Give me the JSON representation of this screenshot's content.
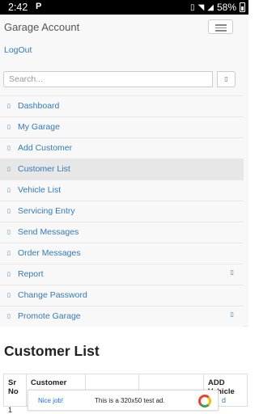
{
  "status_bar": {
    "time": "2:42",
    "battery": "58%",
    "notification_icon": "P"
  },
  "header": {
    "brand": "Garage Account",
    "logout": "LogOut"
  },
  "search": {
    "placeholder": "Search..."
  },
  "menu": {
    "items": [
      {
        "label": "Dashboard"
      },
      {
        "label": "My Garage"
      },
      {
        "label": "Add Customer"
      },
      {
        "label": "Customer List"
      },
      {
        "label": "Vehicle List"
      },
      {
        "label": "Servicing Entry"
      },
      {
        "label": "Send Messages"
      },
      {
        "label": "Order Messages"
      },
      {
        "label": "Report"
      },
      {
        "label": "Change Password"
      },
      {
        "label": "Promote Garage"
      }
    ],
    "active_index": 3
  },
  "content": {
    "title": "Customer List",
    "table": {
      "headers": [
        "Sr No",
        "Customer",
        "",
        "",
        "ADD Vehicle"
      ],
      "first_row_sr": "1",
      "first_row_link": "d"
    }
  },
  "ad": {
    "nice_label": "Nice job!",
    "message": "This is a 320x50 test ad."
  },
  "colors": {
    "link": "#337ab7",
    "navbar_bg": "#f8f8f8",
    "active_bg": "#e7e7e7"
  }
}
